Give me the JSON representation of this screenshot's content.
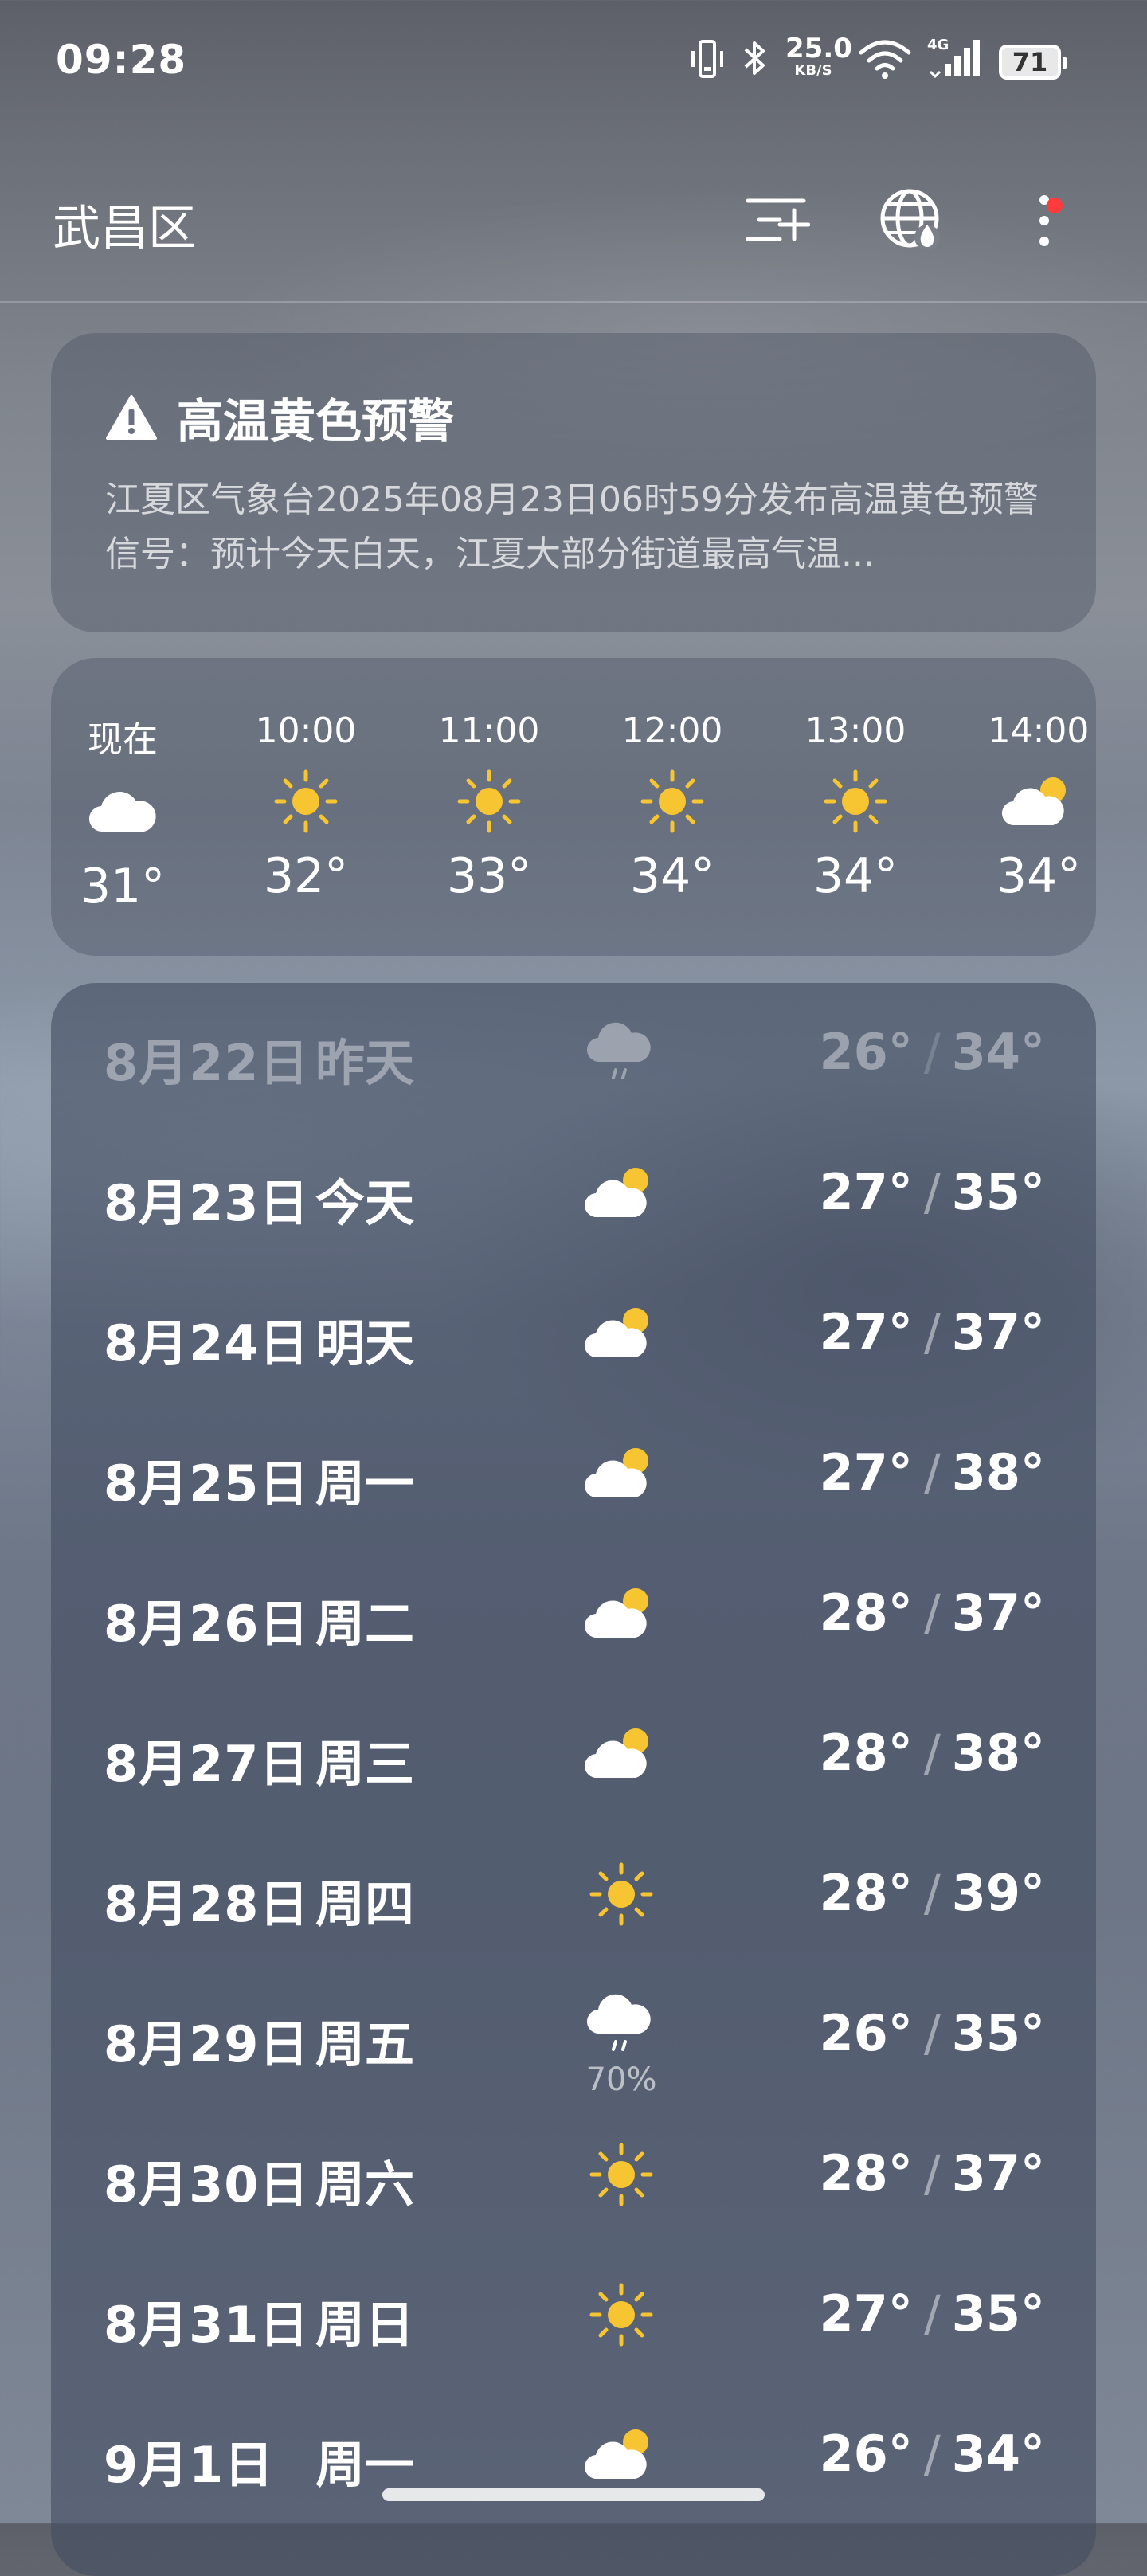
{
  "status_bar": {
    "time": "09:28",
    "net_speed_value": "25.0",
    "net_speed_unit": "KB/S",
    "network_type": "4G",
    "battery_level": "71",
    "icons": [
      "vibrate-icon",
      "bluetooth-icon",
      "wifi-icon",
      "signal-icon",
      "battery-icon"
    ]
  },
  "header": {
    "city": "武昌区",
    "icons": [
      "add-city-icon",
      "globe-icon",
      "more-icon"
    ]
  },
  "alert": {
    "title": "高温黄色预警",
    "body": "江夏区气象台2025年08月23日06时59分发布高温黄色预警信号：预计今天白天，江夏大部分街道最高气温..."
  },
  "hourly": [
    {
      "time": "现在",
      "icon": "cloudy-icon",
      "temp": "31°"
    },
    {
      "time": "10:00",
      "icon": "sunny-icon",
      "temp": "32°"
    },
    {
      "time": "11:00",
      "icon": "sunny-icon",
      "temp": "33°"
    },
    {
      "time": "12:00",
      "icon": "sunny-icon",
      "temp": "34°"
    },
    {
      "time": "13:00",
      "icon": "sunny-icon",
      "temp": "34°"
    },
    {
      "time": "14:00",
      "icon": "partly-cloudy-icon",
      "temp": "34°"
    }
  ],
  "daily": [
    {
      "date": "8月22日",
      "day": "昨天",
      "icon": "rain-icon",
      "low": "26°",
      "high": "34°",
      "precip": ""
    },
    {
      "date": "8月23日",
      "day": "今天",
      "icon": "partly-cloudy-icon",
      "low": "27°",
      "high": "35°",
      "precip": ""
    },
    {
      "date": "8月24日",
      "day": "明天",
      "icon": "partly-cloudy-icon",
      "low": "27°",
      "high": "37°",
      "precip": ""
    },
    {
      "date": "8月25日",
      "day": "周一",
      "icon": "partly-cloudy-icon",
      "low": "27°",
      "high": "38°",
      "precip": ""
    },
    {
      "date": "8月26日",
      "day": "周二",
      "icon": "partly-cloudy-icon",
      "low": "28°",
      "high": "37°",
      "precip": ""
    },
    {
      "date": "8月27日",
      "day": "周三",
      "icon": "partly-cloudy-icon",
      "low": "28°",
      "high": "38°",
      "precip": ""
    },
    {
      "date": "8月28日",
      "day": "周四",
      "icon": "sunny-icon",
      "low": "28°",
      "high": "39°",
      "precip": ""
    },
    {
      "date": "8月29日",
      "day": "周五",
      "icon": "rain-icon",
      "low": "26°",
      "high": "35°",
      "precip": "70%"
    },
    {
      "date": "8月30日",
      "day": "周六",
      "icon": "sunny-icon",
      "low": "28°",
      "high": "37°",
      "precip": ""
    },
    {
      "date": "8月31日",
      "day": "周日",
      "icon": "sunny-icon",
      "low": "27°",
      "high": "35°",
      "precip": ""
    },
    {
      "date": "9月1日",
      "day": "周一",
      "icon": "partly-cloudy-icon",
      "low": "26°",
      "high": "34°",
      "precip": ""
    }
  ],
  "colors": {
    "sun": "#f7c531",
    "cloud": "#ffffff",
    "alert_red_dot": "#ff3b3b"
  }
}
